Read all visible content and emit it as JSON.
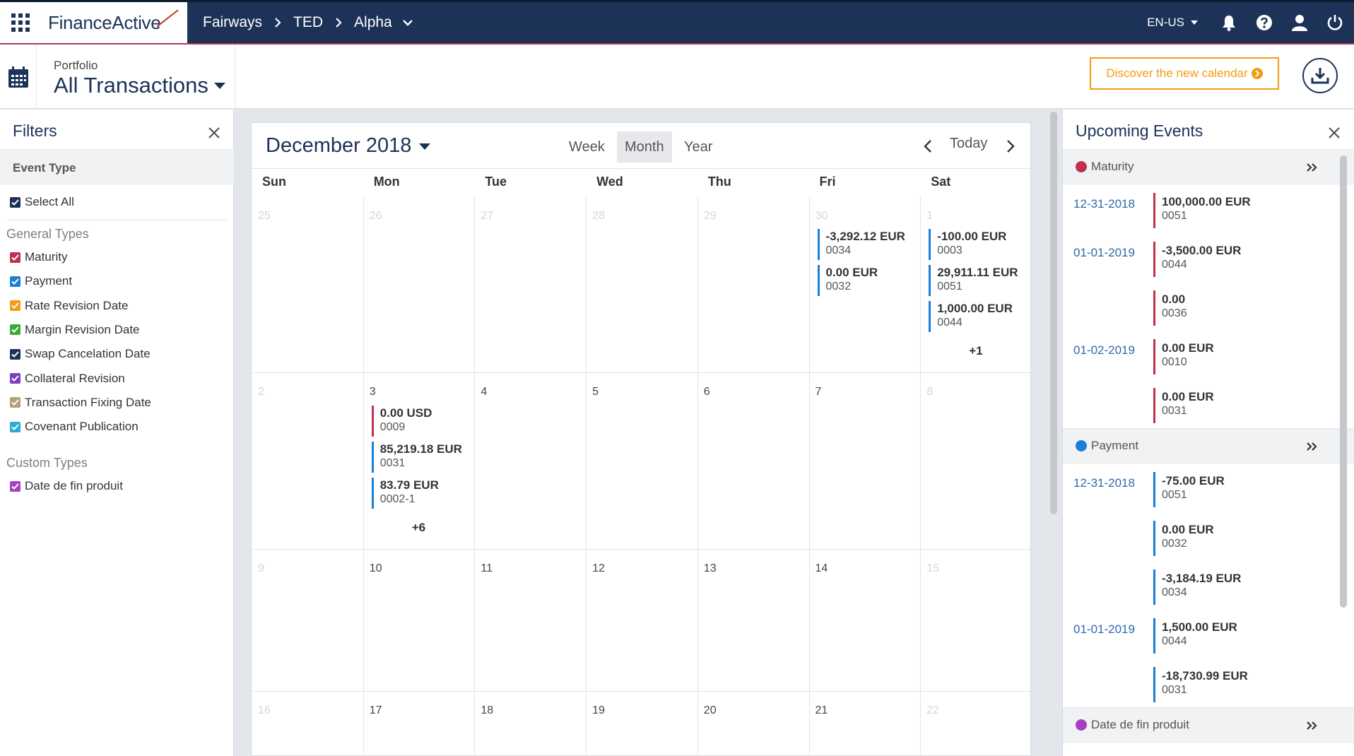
{
  "header": {
    "logo": "FinanceActive",
    "breadcrumbs": [
      "Fairways",
      "TED",
      "Alpha"
    ],
    "language": "EN-US",
    "icons": [
      "bell-icon",
      "help-icon",
      "user-icon",
      "power-icon"
    ]
  },
  "subheader": {
    "portfolio_label": "Portfolio",
    "portfolio_title": "All Transactions",
    "discover_label": "Discover the new calendar"
  },
  "filters": {
    "title": "Filters",
    "event_type": "Event Type",
    "select_all": "Select All",
    "general_label": "General Types",
    "general_types": [
      {
        "label": "Maturity",
        "color": "#c0314f"
      },
      {
        "label": "Payment",
        "color": "#1a7fd6"
      },
      {
        "label": "Rate Revision Date",
        "color": "#f39c12"
      },
      {
        "label": "Margin Revision Date",
        "color": "#3aaa35"
      },
      {
        "label": "Swap Cancelation Date",
        "color": "#1c3257"
      },
      {
        "label": "Collateral Revision",
        "color": "#7b3fc4"
      },
      {
        "label": "Transaction Fixing Date",
        "color": "#b4a07a"
      },
      {
        "label": "Covenant Publication",
        "color": "#2eaad4"
      }
    ],
    "custom_label": "Custom Types",
    "custom_types": [
      {
        "label": "Date de fin produit",
        "color": "#a63fc4"
      }
    ]
  },
  "calendar": {
    "month_label": "December 2018",
    "views": [
      "Week",
      "Month",
      "Year"
    ],
    "active_view": "Month",
    "today_label": "Today",
    "days": [
      "Sun",
      "Mon",
      "Tue",
      "Wed",
      "Thu",
      "Fri",
      "Sat"
    ],
    "weeks": [
      [
        {
          "d": "25",
          "dim": true
        },
        {
          "d": "26",
          "dim": true
        },
        {
          "d": "27",
          "dim": true
        },
        {
          "d": "28",
          "dim": true
        },
        {
          "d": "29",
          "dim": true
        },
        {
          "d": "30",
          "dim": true
        },
        {
          "d": "1",
          "dim": true
        }
      ],
      [
        {
          "d": "2",
          "dim": true
        },
        {
          "d": "3"
        },
        {
          "d": "4"
        },
        {
          "d": "5"
        },
        {
          "d": "6"
        },
        {
          "d": "7"
        },
        {
          "d": "8",
          "dim": true
        }
      ],
      [
        {
          "d": "9",
          "dim": true
        },
        {
          "d": "10"
        },
        {
          "d": "11"
        },
        {
          "d": "12"
        },
        {
          "d": "13"
        },
        {
          "d": "14"
        },
        {
          "d": "15",
          "dim": true
        }
      ],
      [
        {
          "d": "16",
          "dim": true
        },
        {
          "d": "17"
        },
        {
          "d": "18"
        },
        {
          "d": "19"
        },
        {
          "d": "20"
        },
        {
          "d": "21"
        },
        {
          "d": "22",
          "dim": true
        }
      ]
    ],
    "events": {
      "fri30": [
        {
          "amount": "-3,292.12 EUR",
          "ref": "0034",
          "type": "payment"
        },
        {
          "amount": "0.00 EUR",
          "ref": "0032",
          "type": "payment"
        }
      ],
      "sat1": [
        {
          "amount": "-100.00 EUR",
          "ref": "0003",
          "type": "payment"
        },
        {
          "amount": "29,911.11 EUR",
          "ref": "0051",
          "type": "payment"
        },
        {
          "amount": "1,000.00 EUR",
          "ref": "0044",
          "type": "payment"
        }
      ],
      "sat1_more": "+1",
      "mon3": [
        {
          "amount": "0.00 USD",
          "ref": "0009",
          "type": "maturity"
        },
        {
          "amount": "85,219.18 EUR",
          "ref": "0031",
          "type": "payment"
        },
        {
          "amount": "83.79 EUR",
          "ref": "0002-1",
          "type": "payment"
        }
      ],
      "mon3_more": "+6"
    }
  },
  "upcoming": {
    "title": "Upcoming Events",
    "sections": {
      "maturity": {
        "label": "Maturity",
        "color": "#c0314f"
      },
      "payment": {
        "label": "Payment",
        "color": "#1a7fd6"
      },
      "custom": {
        "label": "Date de fin produit",
        "color": "#a63fc4"
      }
    },
    "maturity_items": [
      {
        "date": "12-31-2018",
        "amount": "100,000.00 EUR",
        "ref": "0051"
      },
      {
        "date": "01-01-2019",
        "amount": "-3,500.00 EUR",
        "ref": "0044"
      },
      {
        "date": "",
        "amount": "0.00",
        "ref": "0036"
      },
      {
        "date": "01-02-2019",
        "amount": "0.00 EUR",
        "ref": "0010"
      },
      {
        "date": "",
        "amount": "0.00 EUR",
        "ref": "0031"
      }
    ],
    "payment_items": [
      {
        "date": "12-31-2018",
        "amount": "-75.00 EUR",
        "ref": "0051"
      },
      {
        "date": "",
        "amount": "0.00 EUR",
        "ref": "0032"
      },
      {
        "date": "",
        "amount": "-3,184.19 EUR",
        "ref": "0034"
      },
      {
        "date": "01-01-2019",
        "amount": "1,500.00 EUR",
        "ref": "0044"
      },
      {
        "date": "",
        "amount": "-18,730.99 EUR",
        "ref": "0031"
      }
    ]
  }
}
